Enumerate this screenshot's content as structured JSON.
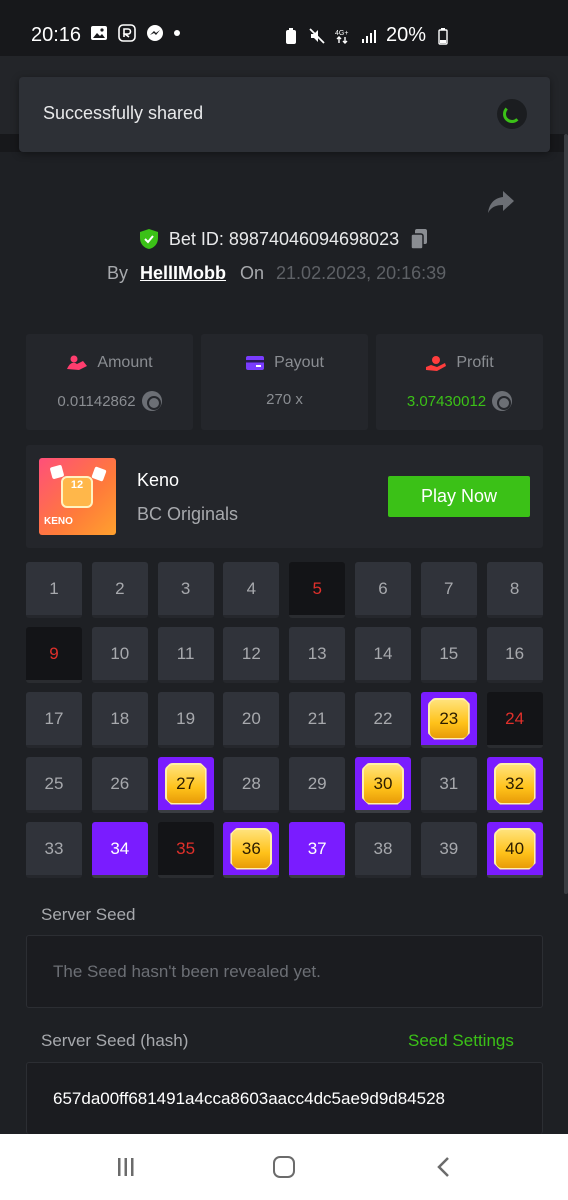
{
  "status_bar": {
    "time": "20:16",
    "network": "4G+",
    "battery": "20%"
  },
  "toast": {
    "message": "Successfully shared"
  },
  "bet": {
    "bet_id_label": "Bet ID: 89874046094698023",
    "by_label": "By",
    "user": "HellIMobb",
    "on_label": "On",
    "date": "21.02.2023, 20:16:39"
  },
  "stats": {
    "amount": {
      "label": "Amount",
      "value": "0.01142862"
    },
    "payout": {
      "label": "Payout",
      "value": "270 x"
    },
    "profit": {
      "label": "Profit",
      "value": "3.07430012"
    }
  },
  "game": {
    "name": "Keno",
    "provider": "BC Originals",
    "thumb_number": "12",
    "thumb_label": "KENO",
    "play_label": "Play Now"
  },
  "keno_grid": {
    "cells": [
      {
        "n": "1",
        "state": "normal"
      },
      {
        "n": "2",
        "state": "normal"
      },
      {
        "n": "3",
        "state": "normal"
      },
      {
        "n": "4",
        "state": "normal"
      },
      {
        "n": "5",
        "state": "miss"
      },
      {
        "n": "6",
        "state": "normal"
      },
      {
        "n": "7",
        "state": "normal"
      },
      {
        "n": "8",
        "state": "normal"
      },
      {
        "n": "9",
        "state": "miss"
      },
      {
        "n": "10",
        "state": "normal"
      },
      {
        "n": "11",
        "state": "normal"
      },
      {
        "n": "12",
        "state": "normal"
      },
      {
        "n": "13",
        "state": "normal"
      },
      {
        "n": "14",
        "state": "normal"
      },
      {
        "n": "15",
        "state": "normal"
      },
      {
        "n": "16",
        "state": "normal"
      },
      {
        "n": "17",
        "state": "normal"
      },
      {
        "n": "18",
        "state": "normal"
      },
      {
        "n": "19",
        "state": "normal"
      },
      {
        "n": "20",
        "state": "normal"
      },
      {
        "n": "21",
        "state": "normal"
      },
      {
        "n": "22",
        "state": "normal"
      },
      {
        "n": "23",
        "state": "hit"
      },
      {
        "n": "24",
        "state": "miss"
      },
      {
        "n": "25",
        "state": "normal"
      },
      {
        "n": "26",
        "state": "normal"
      },
      {
        "n": "27",
        "state": "hit"
      },
      {
        "n": "28",
        "state": "normal"
      },
      {
        "n": "29",
        "state": "normal"
      },
      {
        "n": "30",
        "state": "hit"
      },
      {
        "n": "31",
        "state": "normal"
      },
      {
        "n": "32",
        "state": "hit"
      },
      {
        "n": "33",
        "state": "normal"
      },
      {
        "n": "34",
        "state": "pick"
      },
      {
        "n": "35",
        "state": "miss"
      },
      {
        "n": "36",
        "state": "hit"
      },
      {
        "n": "37",
        "state": "pick"
      },
      {
        "n": "38",
        "state": "normal"
      },
      {
        "n": "39",
        "state": "normal"
      },
      {
        "n": "40",
        "state": "hit"
      }
    ]
  },
  "seeds": {
    "server_seed_label": "Server Seed",
    "server_seed_value": "The Seed hasn't been revealed yet.",
    "server_seed_hash_label": "Server Seed (hash)",
    "seed_settings_label": "Seed Settings",
    "server_seed_hash_value": "657da00ff681491a4cca8603aacc4dc5ae9d9d84528"
  },
  "colors": {
    "accent_green": "#3bc117",
    "pick_purple": "#7a1cff",
    "miss_red": "#e0302b",
    "background": "#1e2024"
  }
}
